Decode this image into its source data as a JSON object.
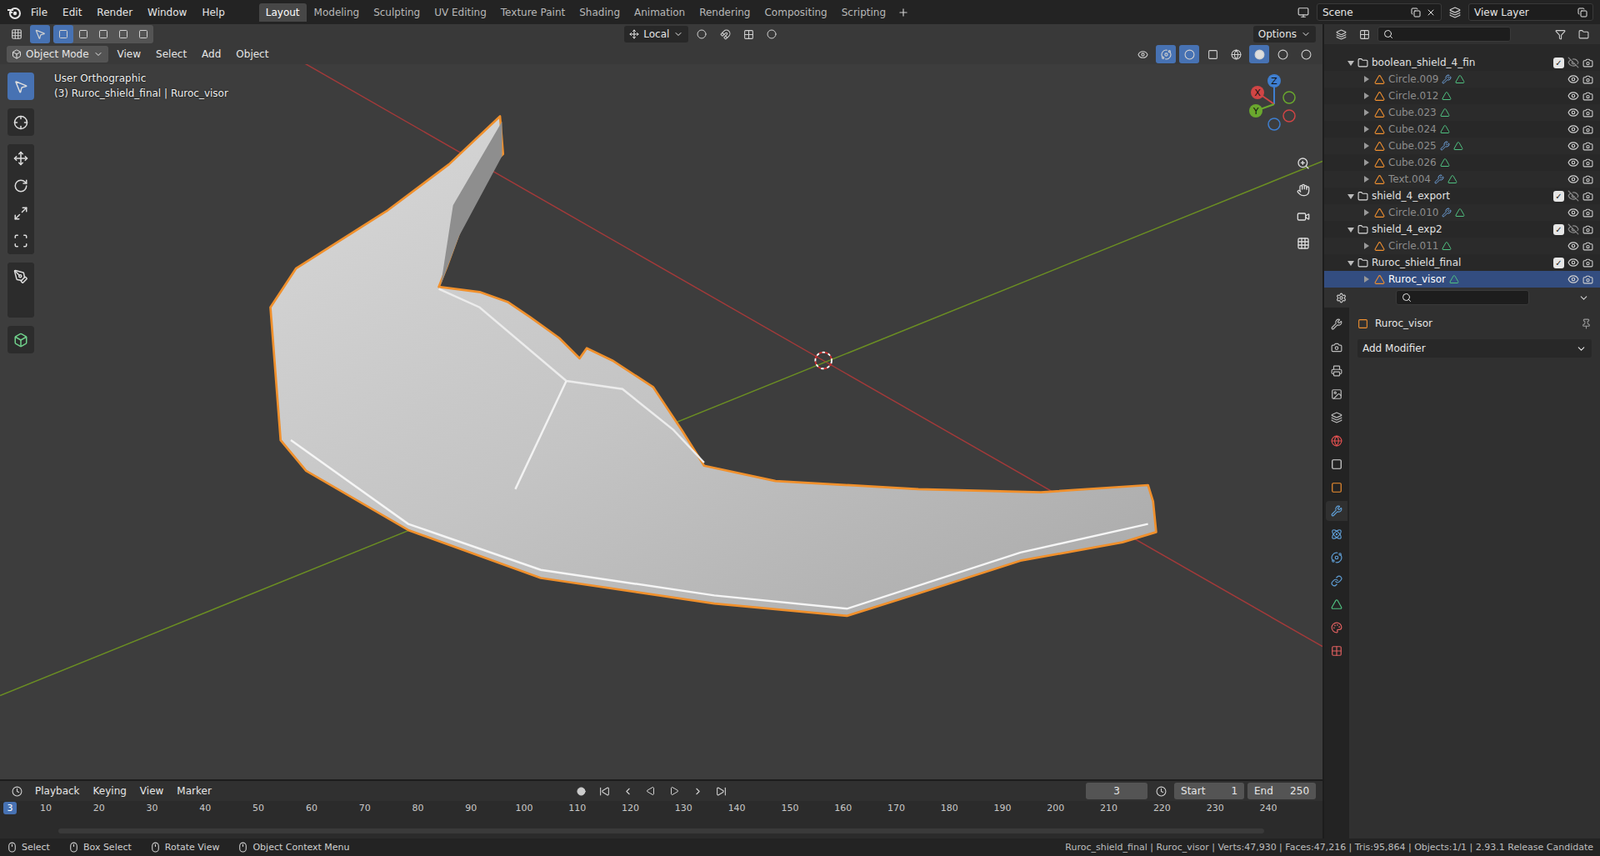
{
  "topbar": {
    "menus": [
      "File",
      "Edit",
      "Render",
      "Window",
      "Help"
    ],
    "workspaces": [
      {
        "label": "Layout",
        "selected": true
      },
      {
        "label": "Modeling",
        "selected": false
      },
      {
        "label": "Sculpting",
        "selected": false
      },
      {
        "label": "UV Editing",
        "selected": false
      },
      {
        "label": "Texture Paint",
        "selected": false
      },
      {
        "label": "Shading",
        "selected": false
      },
      {
        "label": "Animation",
        "selected": false
      },
      {
        "label": "Rendering",
        "selected": false
      },
      {
        "label": "Compositing",
        "selected": false
      },
      {
        "label": "Scripting",
        "selected": false
      }
    ],
    "scene": "Scene",
    "view_layer": "View Layer"
  },
  "tool_header": {
    "orientation": "Local",
    "options": "Options"
  },
  "viewport_header": {
    "mode": "Object Mode",
    "menus": [
      "View",
      "Select",
      "Add",
      "Object"
    ]
  },
  "viewport": {
    "view_name": "User Orthographic",
    "object_info": "(3) Ruroc_shield_final | Ruroc_visor",
    "gizmo": {
      "x": "X",
      "y": "Y",
      "z": "Z"
    }
  },
  "outliner": {
    "items": [
      {
        "name": "boolean_shield_4_fin",
        "kind": "collection",
        "depth": 0,
        "expanded": true,
        "checked": true,
        "visible": false,
        "greyed": false,
        "modifier": false,
        "selected": false
      },
      {
        "name": "Circle.009",
        "kind": "object",
        "depth": 1,
        "expanded": false,
        "checked": false,
        "visible": true,
        "greyed": true,
        "modifier": true,
        "selected": false
      },
      {
        "name": "Circle.012",
        "kind": "object",
        "depth": 1,
        "expanded": false,
        "checked": false,
        "visible": true,
        "greyed": true,
        "modifier": false,
        "selected": false
      },
      {
        "name": "Cube.023",
        "kind": "object",
        "depth": 1,
        "expanded": false,
        "checked": false,
        "visible": true,
        "greyed": true,
        "modifier": false,
        "selected": false
      },
      {
        "name": "Cube.024",
        "kind": "object",
        "depth": 1,
        "expanded": false,
        "checked": false,
        "visible": true,
        "greyed": true,
        "modifier": false,
        "selected": false
      },
      {
        "name": "Cube.025",
        "kind": "object",
        "depth": 1,
        "expanded": false,
        "checked": false,
        "visible": true,
        "greyed": true,
        "modifier": true,
        "selected": false
      },
      {
        "name": "Cube.026",
        "kind": "object",
        "depth": 1,
        "expanded": false,
        "checked": false,
        "visible": true,
        "greyed": true,
        "modifier": false,
        "selected": false
      },
      {
        "name": "Text.004",
        "kind": "object",
        "depth": 1,
        "expanded": false,
        "checked": false,
        "visible": true,
        "greyed": true,
        "modifier": true,
        "selected": false
      },
      {
        "name": "shield_4_export",
        "kind": "collection",
        "depth": 0,
        "expanded": true,
        "checked": true,
        "visible": false,
        "greyed": false,
        "modifier": false,
        "selected": false
      },
      {
        "name": "Circle.010",
        "kind": "object",
        "depth": 1,
        "expanded": false,
        "checked": false,
        "visible": true,
        "greyed": true,
        "modifier": true,
        "selected": false
      },
      {
        "name": "shield_4_exp2",
        "kind": "collection",
        "depth": 0,
        "expanded": true,
        "checked": true,
        "visible": false,
        "greyed": false,
        "modifier": false,
        "selected": false
      },
      {
        "name": "Circle.011",
        "kind": "object",
        "depth": 1,
        "expanded": false,
        "checked": false,
        "visible": true,
        "greyed": true,
        "modifier": false,
        "selected": false
      },
      {
        "name": "Ruroc_shield_final",
        "kind": "collection",
        "depth": 0,
        "expanded": true,
        "checked": true,
        "visible": true,
        "greyed": false,
        "modifier": false,
        "selected": false
      },
      {
        "name": "Ruroc_visor",
        "kind": "object",
        "depth": 1,
        "expanded": false,
        "checked": false,
        "visible": true,
        "greyed": false,
        "modifier": false,
        "selected": true
      }
    ]
  },
  "properties": {
    "object_name": "Ruroc_visor",
    "add_modifier": "Add Modifier",
    "tabs": [
      {
        "selected": false
      },
      {
        "selected": false
      },
      {
        "selected": false
      },
      {
        "selected": false
      },
      {
        "selected": false
      },
      {
        "selected": false
      },
      {
        "selected": false
      },
      {
        "selected": false
      },
      {
        "selected": true
      },
      {
        "selected": false
      },
      {
        "selected": false
      },
      {
        "selected": false
      },
      {
        "selected": false
      },
      {
        "selected": false
      },
      {
        "selected": false
      }
    ]
  },
  "timeline": {
    "menus": [
      "Playback",
      "Keying",
      "View",
      "Marker"
    ],
    "current_frame": "3",
    "start_label": "Start",
    "start": "1",
    "end_label": "End",
    "end": "250",
    "playhead": "3",
    "ticks": [
      "10",
      "20",
      "30",
      "40",
      "50",
      "60",
      "70",
      "80",
      "90",
      "100",
      "110",
      "120",
      "130",
      "140",
      "150",
      "160",
      "170",
      "180",
      "190",
      "200",
      "210",
      "220",
      "230",
      "240"
    ]
  },
  "status_bar": {
    "hints": [
      "Select",
      "Box Select",
      "Rotate View",
      "Object Context Menu"
    ],
    "stats": "Ruroc_shield_final | Ruroc_visor | Verts:47,930 | Faces:47,216 | Tris:95,864 | Objects:1/1 | 2.93.1 Release Candidate"
  }
}
